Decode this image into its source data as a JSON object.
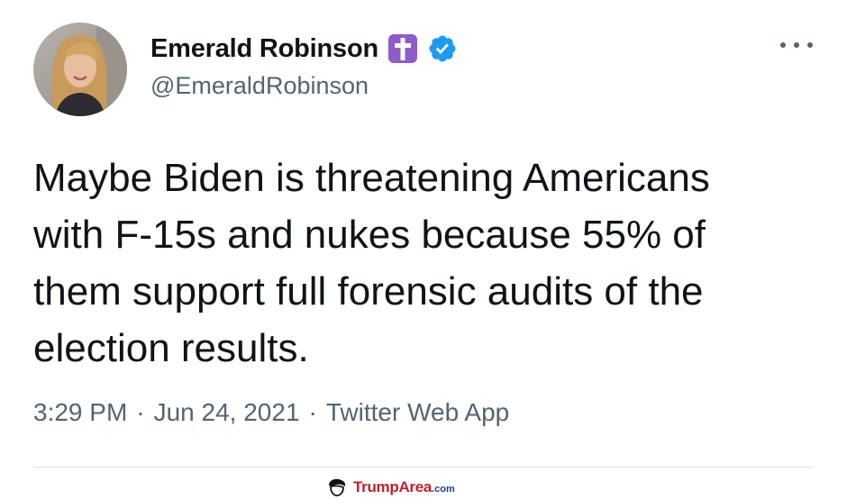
{
  "author": {
    "name": "Emerald Robinson",
    "handle": "@EmeraldRobinson",
    "badge_icons": [
      "latin-cross-emoji-icon",
      "verified-badge-icon"
    ]
  },
  "tweet": {
    "text": "Maybe Biden is threatening Americans\nwith F-15s and nukes because 55% of\nthem support full forensic audits of the\nelection results.",
    "time": "3:29 PM",
    "separator_1": "·",
    "date": "Jun 24, 2021",
    "separator_2": "·",
    "source": "Twitter Web App"
  },
  "menu": {
    "icon": "more-horizontal-icon"
  },
  "watermark": {
    "brand": "TrumpArea",
    "suffix": ".com"
  },
  "colors": {
    "text_primary": "#0f1419",
    "text_secondary": "#536471",
    "verified_blue": "#1d9bf0",
    "cross_badge_purple": "#8e5cc8",
    "watermark_red": "#c0202a",
    "watermark_blue": "#1f3f8a"
  }
}
